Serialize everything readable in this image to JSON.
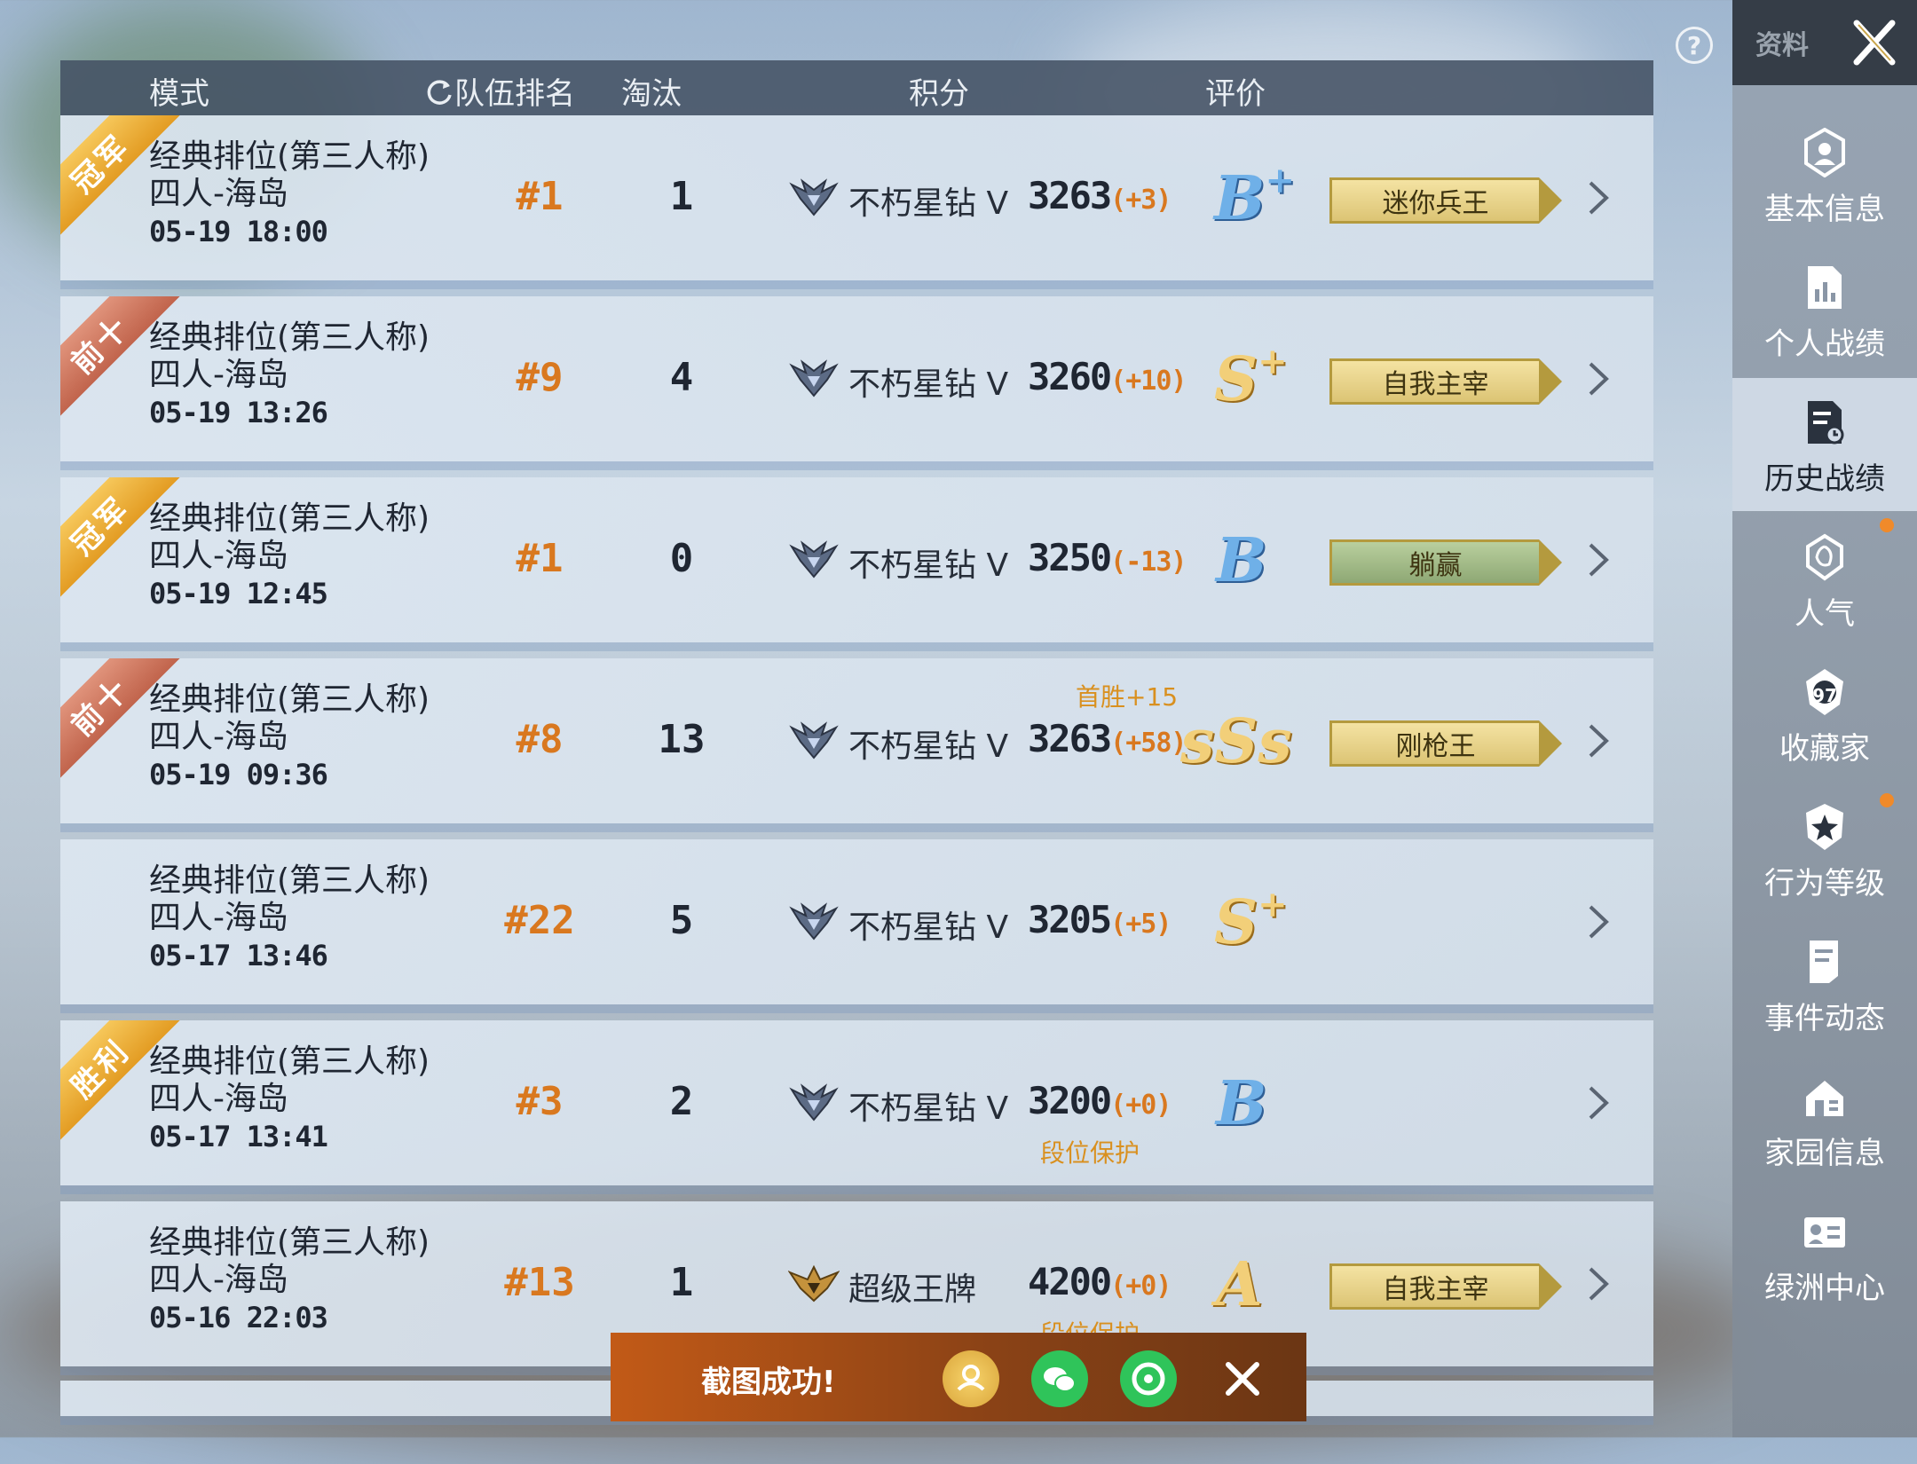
{
  "header": {
    "col_mode": "模式",
    "col_rank": "队伍排名",
    "col_elim": "淘汰",
    "col_score": "积分",
    "col_rating": "评价"
  },
  "help_glyph": "?",
  "rows": [
    {
      "ribbon": "冠军",
      "ribbon_color": "#f0b443",
      "mode": "经典排位(第三人称)",
      "map": "四人-海岛",
      "time": "05-19 18:00",
      "rank": "#1",
      "elim": "1",
      "tier": "不朽星钻 V",
      "score": "3263",
      "delta": "(+3)",
      "rating": "B",
      "rating_sup": "+",
      "rating_color": "blue",
      "badge": "迷你兵王",
      "badge_color": "yellow",
      "note": ""
    },
    {
      "ribbon": "前十",
      "ribbon_color": "#d47a60",
      "mode": "经典排位(第三人称)",
      "map": "四人-海岛",
      "time": "05-19 13:26",
      "rank": "#9",
      "elim": "4",
      "tier": "不朽星钻 V",
      "score": "3260",
      "delta": "(+10)",
      "rating": "S",
      "rating_sup": "+",
      "rating_color": "gold",
      "badge": "自我主宰",
      "badge_color": "yellow",
      "note": ""
    },
    {
      "ribbon": "冠军",
      "ribbon_color": "#f0b443",
      "mode": "经典排位(第三人称)",
      "map": "四人-海岛",
      "time": "05-19 12:45",
      "rank": "#1",
      "elim": "0",
      "tier": "不朽星钻 V",
      "score": "3250",
      "delta": "(-13)",
      "rating": "B",
      "rating_sup": "",
      "rating_color": "blue",
      "badge": "躺赢",
      "badge_color": "green",
      "note": ""
    },
    {
      "ribbon": "前十",
      "ribbon_color": "#d47a60",
      "mode": "经典排位(第三人称)",
      "map": "四人-海岛",
      "time": "05-19 09:36",
      "rank": "#8",
      "elim": "13",
      "tier": "不朽星钻 V",
      "score": "3263",
      "delta": "(+58)",
      "rating": "sSs",
      "rating_sup": "",
      "rating_color": "gold",
      "badge": "刚枪王",
      "badge_color": "yellow",
      "note_above": "首胜+15",
      "note": ""
    },
    {
      "ribbon": "",
      "ribbon_color": "",
      "mode": "经典排位(第三人称)",
      "map": "四人-海岛",
      "time": "05-17 13:46",
      "rank": "#22",
      "elim": "5",
      "tier": "不朽星钻 V",
      "score": "3205",
      "delta": "(+5)",
      "rating": "S",
      "rating_sup": "+",
      "rating_color": "gold",
      "badge": "",
      "badge_color": "",
      "note": ""
    },
    {
      "ribbon": "胜利",
      "ribbon_color": "#f0b443",
      "mode": "经典排位(第三人称)",
      "map": "四人-海岛",
      "time": "05-17 13:41",
      "rank": "#3",
      "elim": "2",
      "tier": "不朽星钻 V",
      "score": "3200",
      "delta": "(+0)",
      "rating": "B",
      "rating_sup": "",
      "rating_color": "blue",
      "badge": "",
      "badge_color": "",
      "note": "段位保护"
    },
    {
      "ribbon": "",
      "ribbon_color": "",
      "mode": "经典排位(第三人称)",
      "map": "四人-海岛",
      "time": "05-16 22:03",
      "rank": "#13",
      "elim": "1",
      "tier": "超级王牌",
      "score": "4200",
      "delta": "(+0)",
      "rating": "A",
      "rating_sup": "",
      "rating_color": "gold",
      "badge": "自我主宰",
      "badge_color": "yellow",
      "note": "段位保护"
    }
  ],
  "sidebar": {
    "top_label": "资料",
    "items": [
      {
        "label": "基本信息",
        "icon": "user-badge-icon"
      },
      {
        "label": "个人战绩",
        "icon": "chart-doc-icon"
      },
      {
        "label": "历史战绩",
        "icon": "history-doc-icon"
      },
      {
        "label": "人气",
        "icon": "popularity-icon"
      },
      {
        "label": "收藏家",
        "icon": "collector-icon",
        "level": "97"
      },
      {
        "label": "行为等级",
        "icon": "behavior-shield-icon"
      },
      {
        "label": "事件动态",
        "icon": "event-doc-icon"
      },
      {
        "label": "家园信息",
        "icon": "home-icon"
      },
      {
        "label": "绿洲中心",
        "icon": "oasis-id-icon"
      }
    ],
    "active": "历史战绩"
  },
  "toast": {
    "message": "截图成功!",
    "actions": [
      "contact-share-icon",
      "wechat-icon",
      "moments-icon",
      "close-icon"
    ]
  },
  "colors": {
    "accent_orange": "#d9781f",
    "header_bg": "#445264",
    "toast_bg": "#b5521a"
  }
}
